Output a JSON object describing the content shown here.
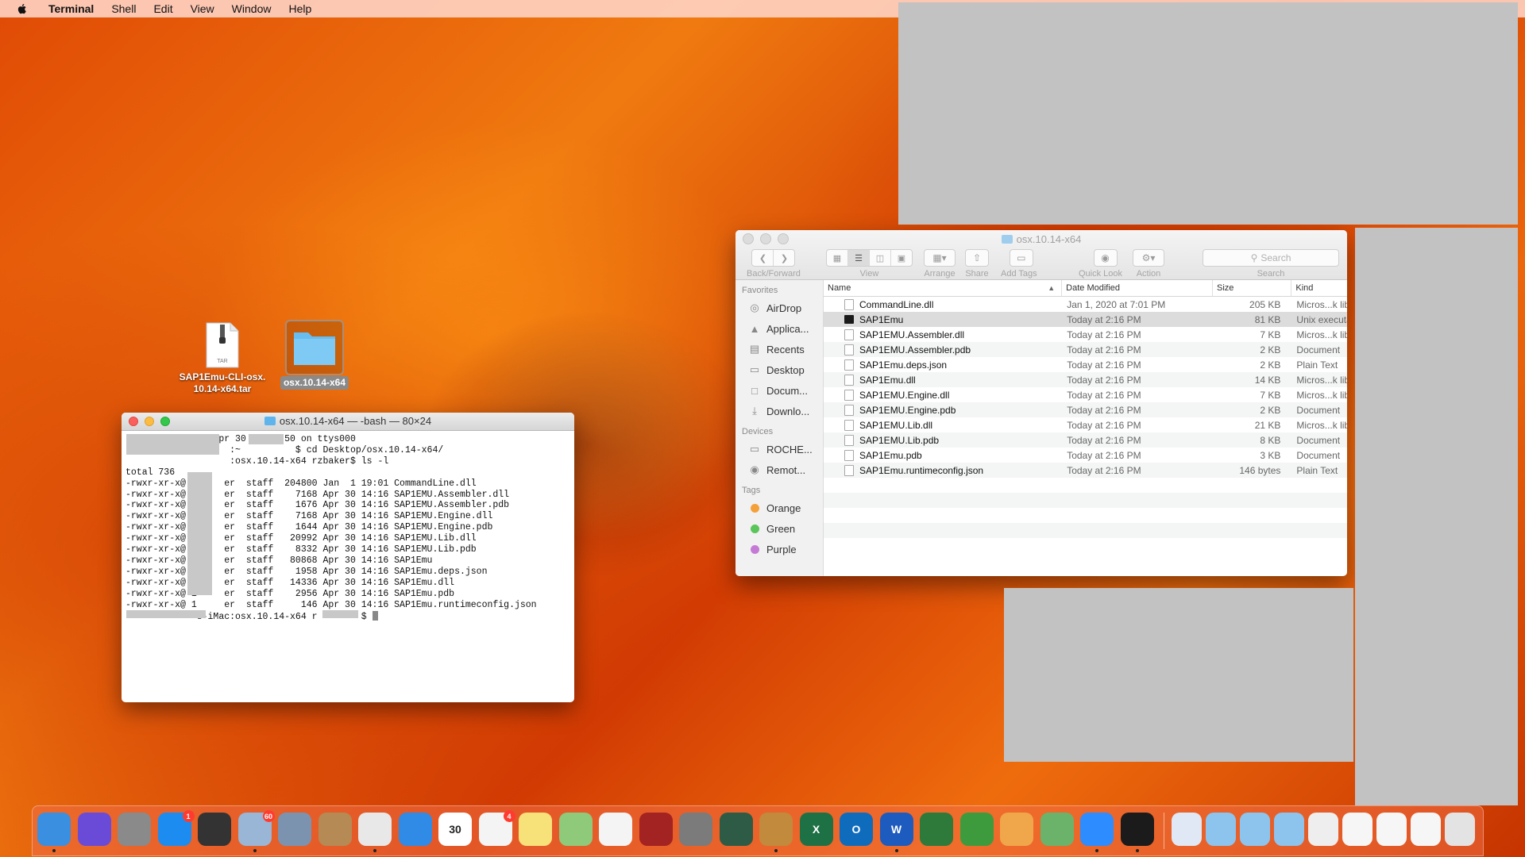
{
  "menubar": {
    "app": "Terminal",
    "items": [
      "Shell",
      "Edit",
      "View",
      "Window",
      "Help"
    ]
  },
  "desktop": {
    "icons": [
      {
        "label": "SAP1Emu-CLI-osx.\n10.14-x64.tar",
        "kind_text": "TAR"
      },
      {
        "label": "osx.10.14-x64"
      }
    ]
  },
  "terminal": {
    "title": "osx.10.14-x64 — -bash — 80×24",
    "lines": [
      "Last login: Thu Apr 30 18:06:50 on ttys000",
      "                   :~          $ cd Desktop/osx.10.14-x64/",
      "                   :osx.10.14-x64 rzbaker$ ls -l",
      "total 736",
      "-rwxr-xr-x@ 1     er  staff  204800 Jan  1 19:01 CommandLine.dll",
      "-rwxr-xr-x@ 1     er  staff    7168 Apr 30 14:16 SAP1EMU.Assembler.dll",
      "-rwxr-xr-x@ 1     er  staff    1676 Apr 30 14:16 SAP1EMU.Assembler.pdb",
      "-rwxr-xr-x@ 1     er  staff    7168 Apr 30 14:16 SAP1EMU.Engine.dll",
      "-rwxr-xr-x@ 1     er  staff    1644 Apr 30 14:16 SAP1EMU.Engine.pdb",
      "-rwxr-xr-x@ 1     er  staff   20992 Apr 30 14:16 SAP1EMU.Lib.dll",
      "-rwxr-xr-x@ 1     er  staff    8332 Apr 30 14:16 SAP1EMU.Lib.pdb",
      "-rwxr-xr-x@ 1     er  staff   80868 Apr 30 14:16 SAP1Emu",
      "-rwxr-xr-x@ 1     er  staff    1958 Apr 30 14:16 SAP1Emu.deps.json",
      "-rwxr-xr-x@ 1     er  staff   14336 Apr 30 14:16 SAP1Emu.dll",
      "-rwxr-xr-x@ 1     er  staff    2956 Apr 30 14:16 SAP1Emu.pdb",
      "-rwxr-xr-x@ 1     er  staff     146 Apr 30 14:16 SAP1Emu.runtimeconfig.json",
      "             s-iMac:osx.10.14-x64 r        $ "
    ]
  },
  "finder": {
    "title": "osx.10.14-x64",
    "toolbar": {
      "back_forward": "Back/Forward",
      "view": "View",
      "arrange": "Arrange",
      "share": "Share",
      "add_tags": "Add Tags",
      "quick_look": "Quick Look",
      "action": "Action",
      "search_placeholder": "Search",
      "search_label": "Search"
    },
    "sidebar": {
      "favorites_header": "Favorites",
      "favorites": [
        {
          "label": "AirDrop",
          "icon": "airdrop-icon"
        },
        {
          "label": "Applica...",
          "icon": "applications-icon"
        },
        {
          "label": "Recents",
          "icon": "recents-icon"
        },
        {
          "label": "Desktop",
          "icon": "desktop-icon"
        },
        {
          "label": "Docum...",
          "icon": "documents-icon"
        },
        {
          "label": "Downlo...",
          "icon": "downloads-icon"
        }
      ],
      "devices_header": "Devices",
      "devices": [
        {
          "label": "ROCHE...",
          "icon": "computer-icon"
        },
        {
          "label": "Remot...",
          "icon": "remote-disc-icon"
        }
      ],
      "tags_header": "Tags",
      "tags": [
        {
          "label": "Orange",
          "color": "#f5a13a"
        },
        {
          "label": "Green",
          "color": "#5ac55a"
        },
        {
          "label": "Purple",
          "color": "#c47bd6"
        }
      ]
    },
    "columns": {
      "name": "Name",
      "date": "Date Modified",
      "size": "Size",
      "kind": "Kind"
    },
    "files": [
      {
        "name": "CommandLine.dll",
        "date": "Jan 1, 2020 at 7:01 PM",
        "size": "205 KB",
        "kind": "Micros...k lib"
      },
      {
        "name": "SAP1Emu",
        "date": "Today at 2:16 PM",
        "size": "81 KB",
        "kind": "Unix executa",
        "exec": true
      },
      {
        "name": "SAP1EMU.Assembler.dll",
        "date": "Today at 2:16 PM",
        "size": "7 KB",
        "kind": "Micros...k lib"
      },
      {
        "name": "SAP1EMU.Assembler.pdb",
        "date": "Today at 2:16 PM",
        "size": "2 KB",
        "kind": "Document"
      },
      {
        "name": "SAP1Emu.deps.json",
        "date": "Today at 2:16 PM",
        "size": "2 KB",
        "kind": "Plain Text"
      },
      {
        "name": "SAP1Emu.dll",
        "date": "Today at 2:16 PM",
        "size": "14 KB",
        "kind": "Micros...k lib"
      },
      {
        "name": "SAP1EMU.Engine.dll",
        "date": "Today at 2:16 PM",
        "size": "7 KB",
        "kind": "Micros...k lib"
      },
      {
        "name": "SAP1EMU.Engine.pdb",
        "date": "Today at 2:16 PM",
        "size": "2 KB",
        "kind": "Document"
      },
      {
        "name": "SAP1EMU.Lib.dll",
        "date": "Today at 2:16 PM",
        "size": "21 KB",
        "kind": "Micros...k lib"
      },
      {
        "name": "SAP1EMU.Lib.pdb",
        "date": "Today at 2:16 PM",
        "size": "8 KB",
        "kind": "Document"
      },
      {
        "name": "SAP1Emu.pdb",
        "date": "Today at 2:16 PM",
        "size": "3 KB",
        "kind": "Document"
      },
      {
        "name": "SAP1Emu.runtimeconfig.json",
        "date": "Today at 2:16 PM",
        "size": "146 bytes",
        "kind": "Plain Text"
      }
    ]
  },
  "dock": {
    "apps": [
      {
        "icon": "finder-icon",
        "color": "#3b8fe0",
        "running": true
      },
      {
        "icon": "siri-icon",
        "color": "#6a4bd8"
      },
      {
        "icon": "launchpad-icon",
        "color": "#8a8a8a"
      },
      {
        "icon": "app-store-icon",
        "color": "#1d8cf0",
        "badge": "1"
      },
      {
        "icon": "dashboard-icon",
        "color": "#333333"
      },
      {
        "icon": "preview-icon",
        "color": "#9ab6d6",
        "badge": "60",
        "running": true
      },
      {
        "icon": "image-capture-icon",
        "color": "#7c93b0"
      },
      {
        "icon": "contacts-icon",
        "color": "#b58a55"
      },
      {
        "icon": "chrome-icon",
        "color": "#e8e8e8",
        "running": true
      },
      {
        "icon": "safari-icon",
        "color": "#2f8be6"
      },
      {
        "icon": "calendar-icon",
        "color": "#ffffff",
        "text": "30"
      },
      {
        "icon": "reminders-icon",
        "color": "#f4f4f4",
        "badge": "4"
      },
      {
        "icon": "notes-icon",
        "color": "#f7e27a"
      },
      {
        "icon": "maps-icon",
        "color": "#8fc97a"
      },
      {
        "icon": "itunes-icon",
        "color": "#f4f4f4"
      },
      {
        "icon": "photo-booth-icon",
        "color": "#a32222"
      },
      {
        "icon": "system-preferences-icon",
        "color": "#7b7b7b"
      },
      {
        "icon": "time-machine-icon",
        "color": "#2e5b45"
      },
      {
        "icon": "keynote-icon",
        "color": "#c28a3c",
        "running": true
      },
      {
        "icon": "excel-icon",
        "color": "#1e7145",
        "text": "X"
      },
      {
        "icon": "outlook-icon",
        "color": "#0f6cbd",
        "text": "O"
      },
      {
        "icon": "word-icon",
        "color": "#1d5bbf",
        "text": "W",
        "running": true
      },
      {
        "icon": "photos-icon",
        "color": "#2d7a3a"
      },
      {
        "icon": "numbers-icon",
        "color": "#3d9b3d"
      },
      {
        "icon": "pages-icon",
        "color": "#f0a64a"
      },
      {
        "icon": "installer-icon",
        "color": "#6bb36b"
      },
      {
        "icon": "zoom-icon",
        "color": "#2d8cff",
        "running": true
      },
      {
        "icon": "terminal-icon",
        "color": "#1b1b1b",
        "running": true
      }
    ],
    "stack": [
      {
        "icon": "jpeg-file-icon",
        "color": "#dfe8f4"
      },
      {
        "icon": "folder-icon",
        "color": "#8cc4ee"
      },
      {
        "icon": "applications-folder-icon",
        "color": "#8cc4ee"
      },
      {
        "icon": "downloads-folder-icon",
        "color": "#8cc4ee"
      },
      {
        "icon": "screenshot-file-icon",
        "color": "#eeeeee"
      },
      {
        "icon": "document-file-icon",
        "color": "#f6f6f6"
      },
      {
        "icon": "document-file-icon",
        "color": "#f6f6f6"
      },
      {
        "icon": "document-file-icon",
        "color": "#f6f6f6"
      },
      {
        "icon": "trash-icon",
        "color": "#e3e3e3"
      }
    ]
  }
}
